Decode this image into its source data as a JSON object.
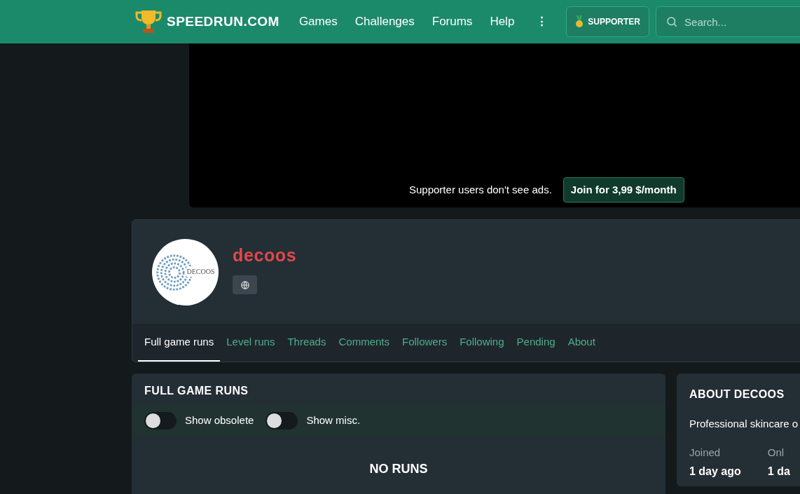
{
  "header": {
    "logo": "SPEEDRUN.COM",
    "nav": [
      "Games",
      "Challenges",
      "Forums",
      "Help"
    ],
    "more": "⋮",
    "supporter": "SUPPORTER",
    "search": {
      "placeholder": "Search..."
    }
  },
  "ad": {
    "message": "Supporter users don't see ads.",
    "button": "Join for 3,99 $/month"
  },
  "profile": {
    "name": "decoos",
    "avatar_text": "DECOOS"
  },
  "tabs": [
    {
      "label": "Full game runs",
      "selected": true
    },
    {
      "label": "Level runs",
      "selected": false
    },
    {
      "label": "Threads",
      "selected": false
    },
    {
      "label": "Comments",
      "selected": false
    },
    {
      "label": "Followers",
      "selected": false
    },
    {
      "label": "Following",
      "selected": false
    },
    {
      "label": "Pending",
      "selected": false
    },
    {
      "label": "About",
      "selected": false
    }
  ],
  "runs": {
    "title": "FULL GAME RUNS",
    "toggles": [
      {
        "label": "Show obsolete",
        "on": false
      },
      {
        "label": "Show misc.",
        "on": false
      }
    ],
    "empty": "NO RUNS"
  },
  "about": {
    "title": "ABOUT DECOOS",
    "bio": "Professional skincare o",
    "stats": [
      {
        "label": "Joined",
        "value": "1 day ago"
      },
      {
        "label": "Onl",
        "value": "1 da"
      }
    ]
  }
}
